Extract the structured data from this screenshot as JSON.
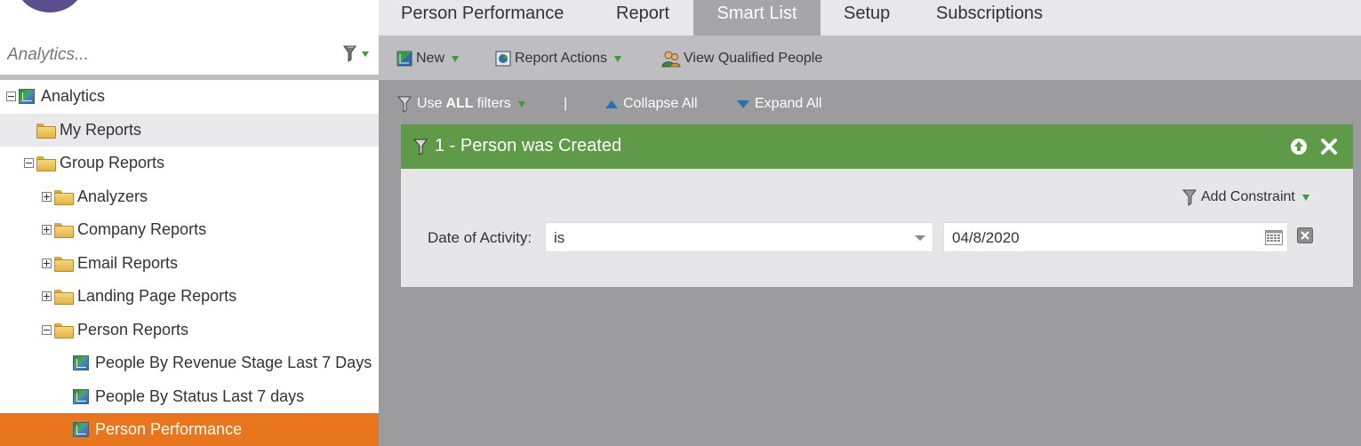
{
  "search": {
    "placeholder": "Analytics..."
  },
  "tree": [
    {
      "label": "Analytics",
      "level": 0,
      "expander": "minus",
      "icon": "report-icon"
    },
    {
      "label": "My Reports",
      "level": 1,
      "expander": "none",
      "icon": "folder-icon",
      "state": "hover"
    },
    {
      "label": "Group Reports",
      "level": 1,
      "expander": "minus",
      "icon": "folder-icon"
    },
    {
      "label": "Analyzers",
      "level": 2,
      "expander": "plus",
      "icon": "folder-icon"
    },
    {
      "label": "Company Reports",
      "level": 2,
      "expander": "plus",
      "icon": "folder-icon"
    },
    {
      "label": "Email Reports",
      "level": 2,
      "expander": "plus",
      "icon": "folder-icon"
    },
    {
      "label": "Landing Page Reports",
      "level": 2,
      "expander": "plus",
      "icon": "folder-icon"
    },
    {
      "label": "Person Reports",
      "level": 2,
      "expander": "minus",
      "icon": "folder-icon"
    },
    {
      "label": "People By Revenue Stage Last 7 Days",
      "level": 3,
      "expander": "none",
      "icon": "report-icon"
    },
    {
      "label": "People By Status Last 7 days",
      "level": 3,
      "expander": "none",
      "icon": "report-icon"
    },
    {
      "label": "Person Performance",
      "level": 3,
      "expander": "none",
      "icon": "report-icon",
      "state": "selected"
    }
  ],
  "tabs": [
    {
      "label": "Person Performance",
      "active": false
    },
    {
      "label": "Report",
      "active": false
    },
    {
      "label": "Smart List",
      "active": true
    },
    {
      "label": "Setup",
      "active": false
    },
    {
      "label": "Subscriptions",
      "active": false
    }
  ],
  "toolbar": {
    "new_label": "New",
    "report_actions_label": "Report Actions",
    "view_qualified_label": "View Qualified People"
  },
  "filterbar": {
    "use_prefix": "Use",
    "use_bold": "ALL",
    "use_suffix": "filters",
    "separator": "|",
    "collapse_label": "Collapse All",
    "expand_label": "Expand All"
  },
  "filter": {
    "title": "1 - Person was Created",
    "add_constraint_label": "Add Constraint",
    "row_label": "Date of Activity:",
    "operator_value": "is",
    "date_value": "04/8/2020"
  },
  "colors": {
    "accent_orange": "#e8761e",
    "filter_green": "#5e9a48",
    "brand_purple": "#5b4e8f",
    "background_gray": "#9c9c9f"
  }
}
